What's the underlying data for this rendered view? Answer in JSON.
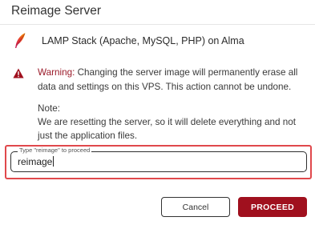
{
  "dialog": {
    "title": "Reimage Server",
    "image": {
      "icon": "apache-feather-icon",
      "name": "LAMP Stack (Apache, MySQL, PHP) on Alma"
    },
    "warning": {
      "icon": "warning-triangle-icon",
      "label": "Warning:",
      "text": " Changing the server image will permanently erase all data and settings on this VPS. This action cannot be undone."
    },
    "note": {
      "heading": "Note:",
      "text": "We are resetting the server, so it will delete everything and not just the application files."
    },
    "confirm_field": {
      "label": "Type \"reimage\" to proceed",
      "value": "reimage"
    },
    "buttons": {
      "cancel": "Cancel",
      "proceed": "PROCEED"
    },
    "colors": {
      "accent": "#a0101e",
      "highlight": "#e0484c",
      "warning_label": "#9b1b2a"
    }
  }
}
